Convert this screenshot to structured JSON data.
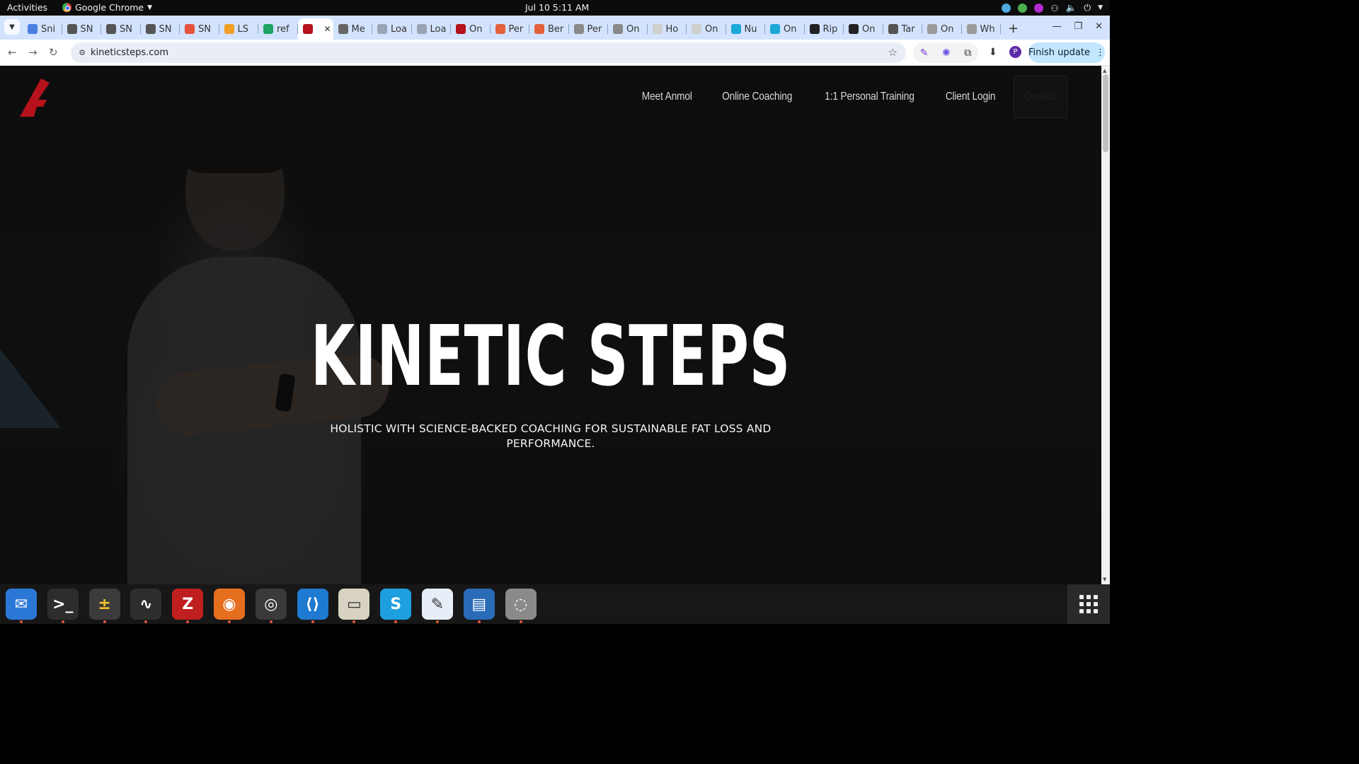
{
  "system_bar": {
    "activities": "Activities",
    "app_name": "Google Chrome",
    "clock": "Jul 10  5:11 AM"
  },
  "browser": {
    "tabs": [
      {
        "label": "Sni",
        "color": "#4a7fe0"
      },
      {
        "label": "SN",
        "color": "#555555"
      },
      {
        "label": "SN",
        "color": "#555555"
      },
      {
        "label": "SN",
        "color": "#555555"
      },
      {
        "label": "SN",
        "color": "#e5533d"
      },
      {
        "label": "LS",
        "color": "#f0a024"
      },
      {
        "label": "ref",
        "color": "#1fa463"
      },
      {
        "label": "",
        "color": "#b5121b",
        "active": true
      },
      {
        "label": "Me",
        "color": "#666666"
      },
      {
        "label": "Loa",
        "color": "#9aa4b4"
      },
      {
        "label": "Loa",
        "color": "#9aa4b4"
      },
      {
        "label": "On",
        "color": "#b5121b"
      },
      {
        "label": "Per",
        "color": "#e2603a"
      },
      {
        "label": "Ber",
        "color": "#e2603a"
      },
      {
        "label": "Per",
        "color": "#8a8a8a"
      },
      {
        "label": "On",
        "color": "#8a8a8a"
      },
      {
        "label": "Ho",
        "color": "#cfcfcf"
      },
      {
        "label": "On",
        "color": "#cfcfcf"
      },
      {
        "label": "Nu",
        "color": "#1ba8d6"
      },
      {
        "label": "On",
        "color": "#1ba8d6"
      },
      {
        "label": "Rip",
        "color": "#222222"
      },
      {
        "label": "On",
        "color": "#222222"
      },
      {
        "label": "Tar",
        "color": "#555555"
      },
      {
        "label": "On",
        "color": "#9a9a9a"
      },
      {
        "label": "Wh",
        "color": "#9a9a9a"
      }
    ],
    "url": "kineticsteps.com",
    "finish_update": "Finish update",
    "profile_initial": "P"
  },
  "page": {
    "nav": [
      "Meet Anmol",
      "Online Coaching",
      "1:1 Personal Training",
      "Client Login",
      "Contact"
    ],
    "hero_title": "KINETIC STEPS",
    "hero_subtitle": "HOLISTIC WITH SCIENCE-BACKED COACHING FOR SUSTAINABLE FAT LOSS AND PERFORMANCE.",
    "brand_colors": {
      "logo_red": "#b5121b",
      "logo_dark": "#0d0d0d"
    }
  },
  "dock": {
    "items": [
      {
        "icon": "thunderbird-icon",
        "color": "#2b77d6"
      },
      {
        "icon": "terminal-icon",
        "color": "#2d2d2d"
      },
      {
        "icon": "calculator-icon",
        "color": "#3b3b3b"
      },
      {
        "icon": "system-monitor-icon",
        "color": "#2d2d2d"
      },
      {
        "icon": "filezilla-icon",
        "color": "#bf1f1f"
      },
      {
        "icon": "firefox-icon",
        "color": "#e66f1f"
      },
      {
        "icon": "chrome-icon",
        "color": "#3a3a3a"
      },
      {
        "icon": "vscode-icon",
        "color": "#1f7ad1"
      },
      {
        "icon": "files-icon",
        "color": "#d8d2c3"
      },
      {
        "icon": "skype-icon",
        "color": "#1ea0e0"
      },
      {
        "icon": "text-editor-icon",
        "color": "#e8eef8"
      },
      {
        "icon": "libreoffice-writer-icon",
        "color": "#2a6bb8"
      },
      {
        "icon": "disk-icon",
        "color": "#8a8a8a"
      }
    ]
  }
}
